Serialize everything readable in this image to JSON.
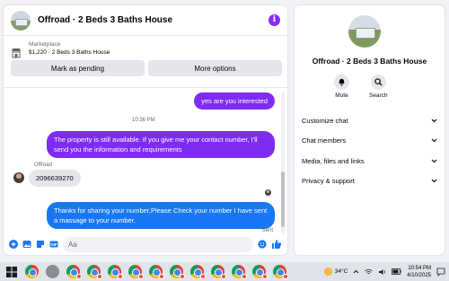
{
  "chat": {
    "title": "Offroad · 2 Beds 3 Baths House",
    "marketplace_label": "Marketplace",
    "listing": "$1,220 · 2 Beds 3 Baths House",
    "mark_pending_label": "Mark as pending",
    "more_options_label": "More options",
    "messages": [
      {
        "text": "yes are you interested"
      },
      {
        "time": "10:36 PM"
      },
      {
        "text": "The property is still available. If you give me your contact number, I'll send you the information and requirements"
      },
      {
        "sender": "Offroad",
        "text": "2096639270"
      },
      {
        "text": "Thanks for sharing your number,Please Check your number I have sent a massage to your number."
      }
    ],
    "status": "Sent",
    "composer_placeholder": "Aa"
  },
  "sidebar": {
    "title": "Offroad · 2 Beds 3 Baths House",
    "mute_label": "Mute",
    "search_label": "Search",
    "items": [
      {
        "label": "Customize chat"
      },
      {
        "label": "Chat members"
      },
      {
        "label": "Media, files and links"
      },
      {
        "label": "Privacy & support"
      }
    ]
  },
  "taskbar": {
    "temperature": "34°C",
    "time": "10:54 PM",
    "date": "4/10/2025"
  },
  "colors": {
    "accent_purple": "#7e2cf3",
    "accent_blue": "#1877f2"
  }
}
